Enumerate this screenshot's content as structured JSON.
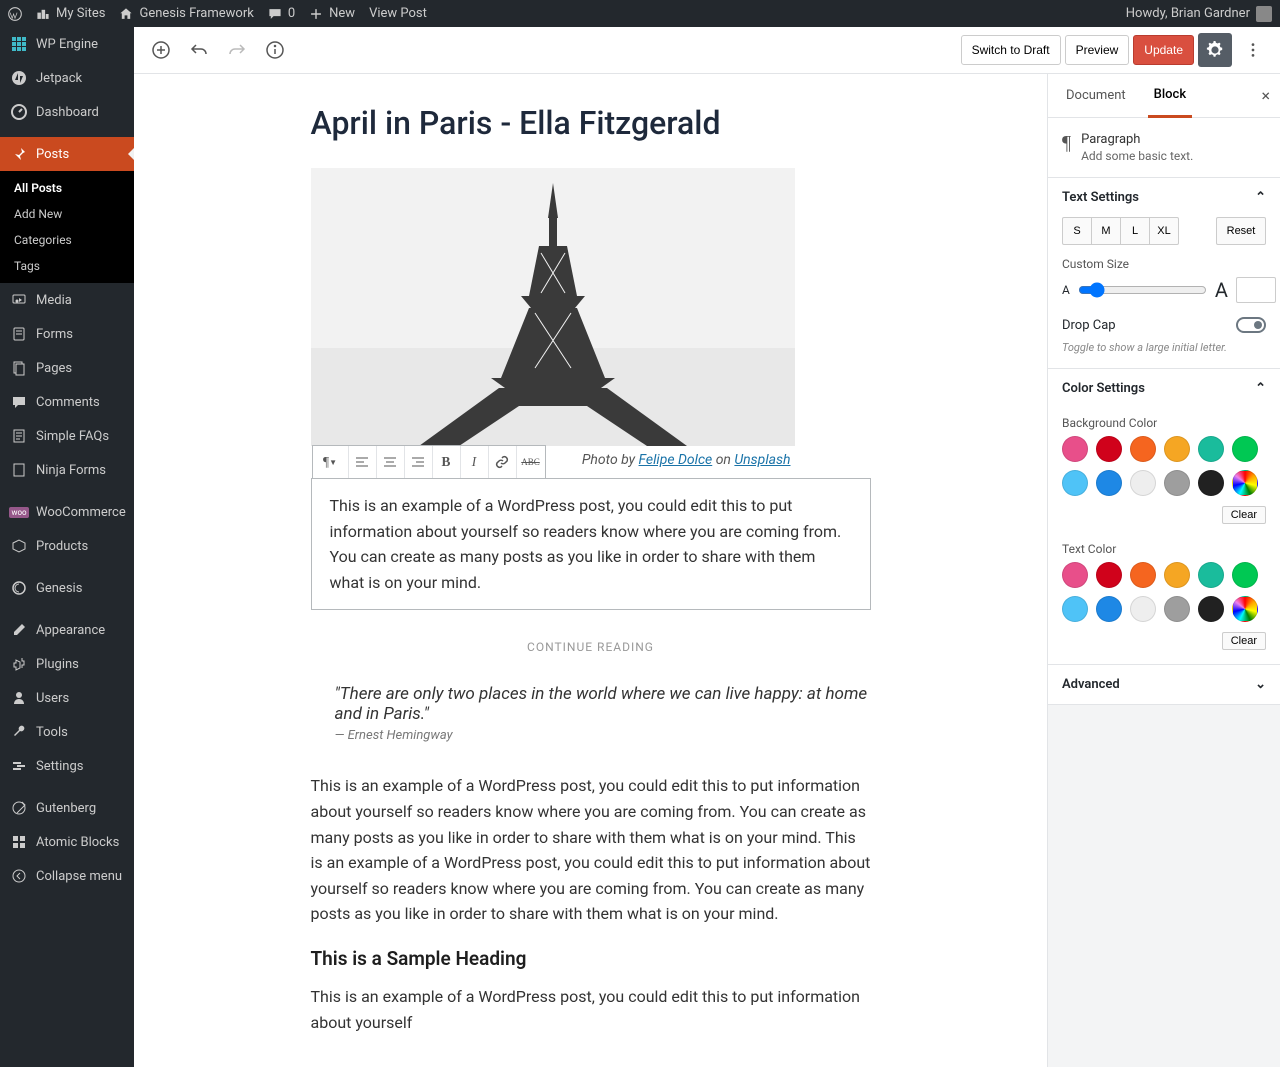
{
  "adminbar": {
    "my_sites": "My Sites",
    "site_name": "Genesis Framework",
    "comments": "0",
    "new": "New",
    "view_post": "View Post",
    "howdy": "Howdy, Brian Gardner"
  },
  "sidebar": {
    "wpengine": "WP Engine",
    "jetpack": "Jetpack",
    "dashboard": "Dashboard",
    "posts": "Posts",
    "posts_sub": {
      "all": "All Posts",
      "add": "Add New",
      "cats": "Categories",
      "tags": "Tags"
    },
    "media": "Media",
    "forms": "Forms",
    "pages": "Pages",
    "comments": "Comments",
    "faqs": "Simple FAQs",
    "ninja": "Ninja Forms",
    "woo": "WooCommerce",
    "products": "Products",
    "genesis": "Genesis",
    "appearance": "Appearance",
    "plugins": "Plugins",
    "users": "Users",
    "tools": "Tools",
    "settings": "Settings",
    "gutenberg": "Gutenberg",
    "atomic": "Atomic Blocks",
    "collapse": "Collapse menu"
  },
  "toolbar": {
    "switch_draft": "Switch to Draft",
    "preview": "Preview",
    "update": "Update"
  },
  "post": {
    "title": "April in Paris - Ella Fitzgerald",
    "caption_prefix": "Photo by ",
    "caption_author": "Felipe Dolce",
    "caption_on": " on ",
    "caption_source": "Unsplash",
    "p1": "This is an example of a WordPress post, you could edit this to put information about yourself so readers know where you are coming from. You can create as many posts as you like in order to share with them what is on your mind.",
    "continue": "CONTINUE READING",
    "quote": "\"There are only two places in the world where we can live happy: at home and in Paris.\"",
    "quote_cite": "— Ernest Hemingway",
    "p2": "This is an example of a WordPress post, you could edit this to put information about yourself so readers know where you are coming from. You can create as many posts as you like in order to share with them what is on your mind. This is an example of a WordPress post, you could edit this to put information about yourself so readers know where you are coming from. You can create as many posts as you like in order to share with them what is on your mind.",
    "h2": "This is a Sample Heading",
    "p3": "This is an example of a WordPress post, you could edit this to put information about yourself"
  },
  "panel": {
    "tab_doc": "Document",
    "tab_block": "Block",
    "block_name": "Paragraph",
    "block_desc": "Add some basic text.",
    "text_settings": "Text Settings",
    "sizes": {
      "s": "S",
      "m": "M",
      "l": "L",
      "xl": "XL"
    },
    "reset": "Reset",
    "custom_size": "Custom Size",
    "drop_cap": "Drop Cap",
    "drop_cap_hint": "Toggle to show a large initial letter.",
    "color_settings": "Color Settings",
    "bg_color": "Background Color",
    "text_color": "Text Color",
    "clear": "Clear",
    "advanced": "Advanced",
    "colors": [
      "#e84f8a",
      "#d0021b",
      "#f5651f",
      "#f5a623",
      "#1abc9c",
      "#00c853",
      "#4fc3f7",
      "#1e88e5",
      "#eeeeee",
      "#9e9e9e",
      "#212121"
    ]
  }
}
